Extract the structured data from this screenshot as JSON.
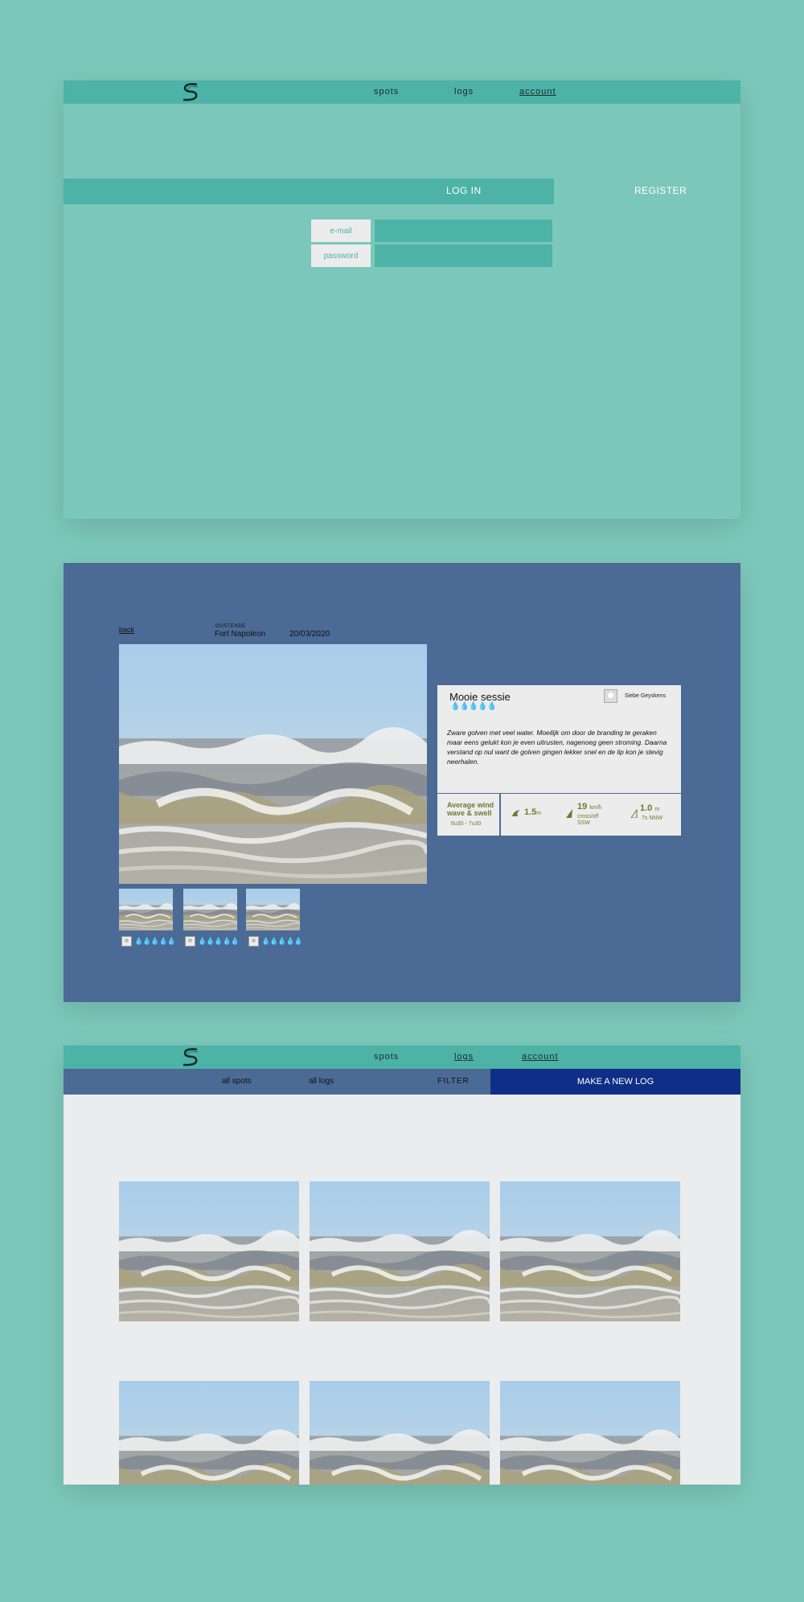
{
  "panel1": {
    "nav": {
      "spots": "spots",
      "logs": "logs",
      "account": "account"
    },
    "tabs": {
      "login": "LOG IN",
      "register": "REGISTER"
    },
    "form": {
      "email_label": "e-mail",
      "password_label": "password"
    }
  },
  "panel2": {
    "back": "back",
    "city": "OOSTENDE",
    "spot": "Fort Napoleon",
    "date": "20/03/2020",
    "card": {
      "title": "Mooie sessie",
      "rating": "💧💧💧💧💧",
      "user": "Siebe Geyskens",
      "text": "Zware golven met veel water. Moeilijk om door de branding te geraken maar eens gelukt kon je even uitrusten, nagenoeg geen stroming. Daarna verstand op nul want de golven gingen lekker snel en de lip kon je stevig neerhalen."
    },
    "stats": {
      "label": "Average wind wave & swell",
      "time": "6u30 - 7u30",
      "wave": "1.5",
      "wave_unit": "m",
      "wind": "19",
      "wind_unit": "km/h",
      "wind_dir": "cross/off",
      "wind_compass": "SSW",
      "swell": "1.0",
      "swell_unit": "m",
      "swell_period": "7s NNW"
    },
    "thumb_ratings": [
      "💧💧💧💧💧",
      "💧💧💧💧💧",
      "💧💧💧💧💧"
    ]
  },
  "panel3": {
    "nav": {
      "spots": "spots",
      "logs": "logs",
      "account": "account"
    },
    "subnav": {
      "all_spots": "all spots",
      "all_logs": "all logs",
      "filter": "FILTER",
      "new_log": "MAKE A NEW LOG"
    }
  },
  "colors": {
    "background": "#7cc7bb",
    "teal": "#4db3a6",
    "blue": "#4b6b96",
    "navy": "#0f2e87",
    "olive": "#6e7a32"
  }
}
